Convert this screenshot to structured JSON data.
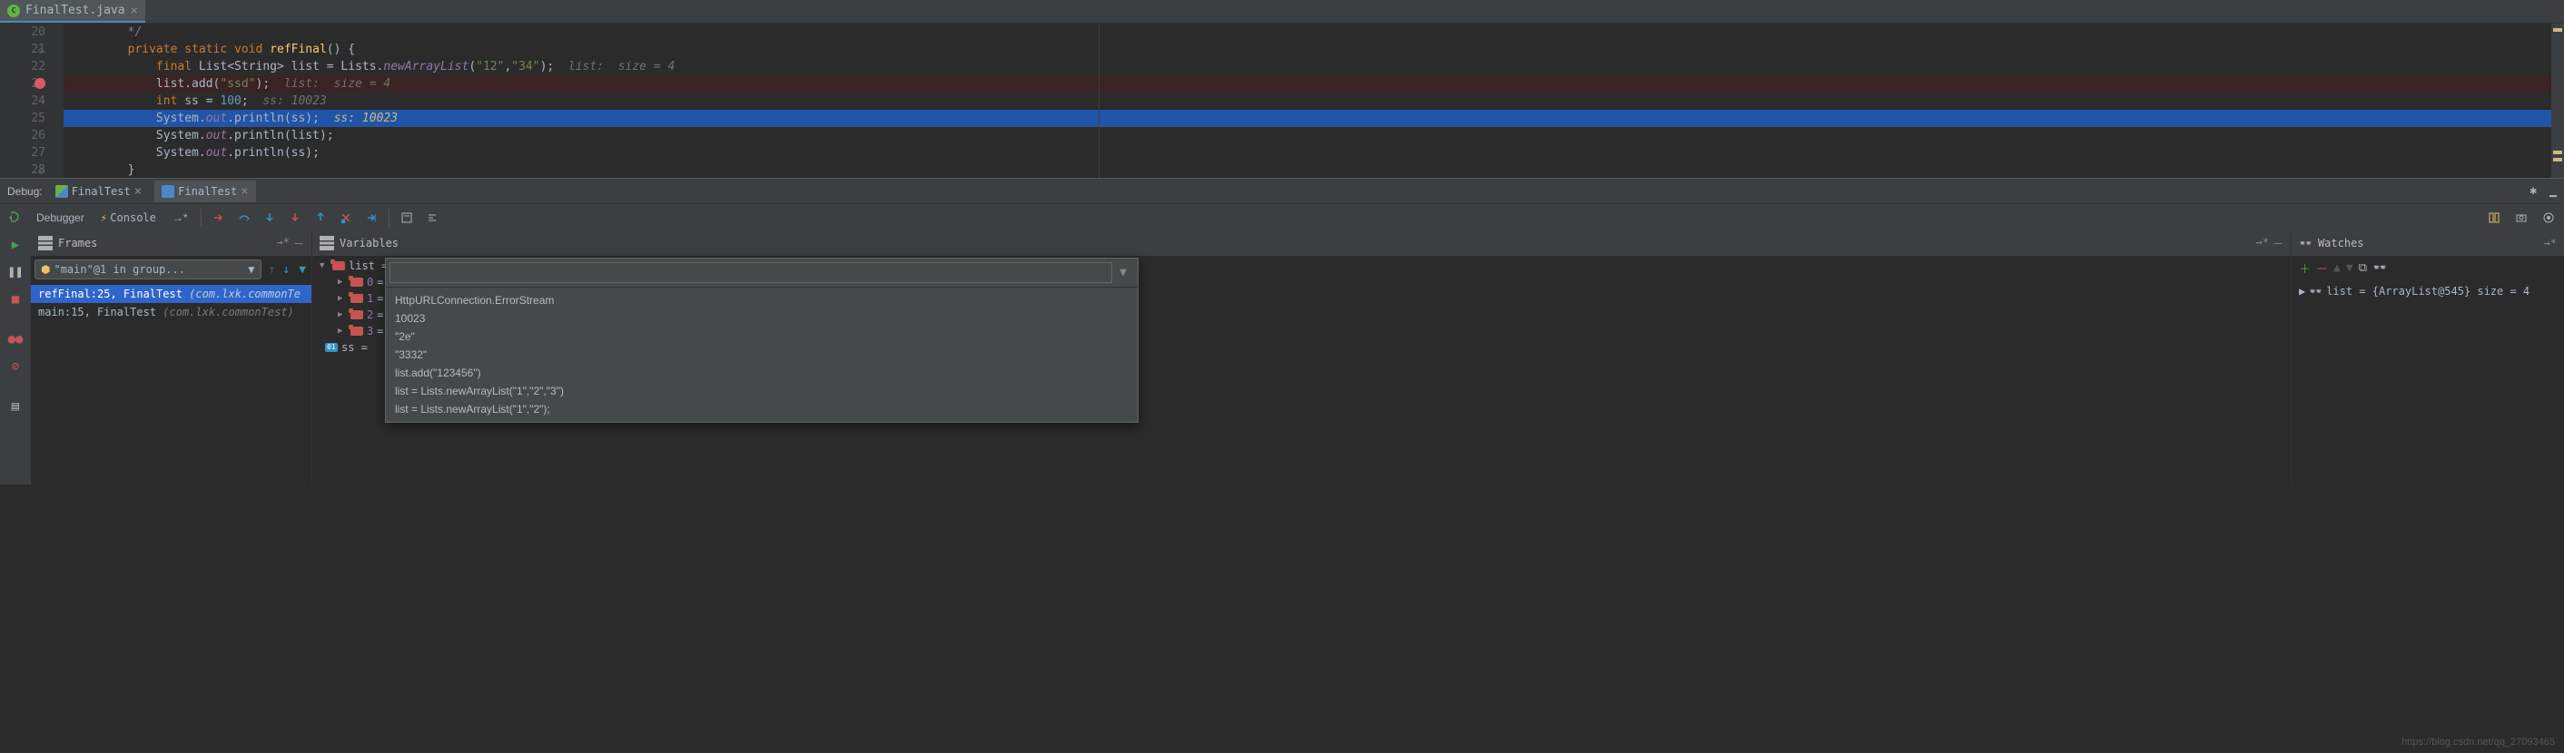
{
  "tab": {
    "filename": "FinalTest.java"
  },
  "gutter": [
    "20",
    "21",
    "22",
    "23",
    "24",
    "25",
    "26",
    "27",
    "28"
  ],
  "breakpoint_line": "23",
  "current_line": "25",
  "code": {
    "l20": "        */",
    "l21_indent": "        ",
    "l21_kw1": "private static void ",
    "l21_fn": "refFinal",
    "l21_rest": "() {",
    "l22_indent": "            ",
    "l22_kw": "final ",
    "l22_type": "List<String> list = Lists.",
    "l22_fn": "newArrayList",
    "l22_p1": "(",
    "l22_s1": "\"12\"",
    "l22_c": ",",
    "l22_s2": "\"34\"",
    "l22_p2": ");  ",
    "l22_hint": "list:  size = 4",
    "l23_indent": "            ",
    "l23_a": "list.add(",
    "l23_s": "\"ssd\"",
    "l23_b": ");  ",
    "l23_hint": "list:  size = 4",
    "l24_indent": "            ",
    "l24_kw": "int ",
    "l24_a": "ss = ",
    "l24_n": "100",
    "l24_b": ";  ",
    "l24_hint": "ss: 10023",
    "l25_indent": "            ",
    "l25_a": "System.",
    "l25_out": "out",
    "l25_b": ".println(ss);  ",
    "l25_hint": "ss: 10023",
    "l26_indent": "            ",
    "l26_a": "System.",
    "l26_out": "out",
    "l26_b": ".println(list);",
    "l27_indent": "            ",
    "l27_a": "System.",
    "l27_out": "out",
    "l27_b": ".println(ss);",
    "l28": "        }"
  },
  "debug": {
    "label": "Debug:",
    "tab1": "FinalTest",
    "tab2": "FinalTest"
  },
  "debugger_tabs": {
    "debugger": "Debugger",
    "console": "Console",
    "arrow": "→*"
  },
  "frames": {
    "title": "Frames",
    "dropdown": "\"main\"@1 in group...",
    "item1_a": "refFinal:25, FinalTest ",
    "item1_b": "(com.lxk.commonTe",
    "item2_a": "main:15, FinalTest ",
    "item2_b": "(com.lxk.commonTest)"
  },
  "variables": {
    "title": "Variables",
    "list_label": "list = ",
    "items": [
      {
        "idx": "0",
        "val": " = "
      },
      {
        "idx": "1",
        "val": " = "
      },
      {
        "idx": "2",
        "val": " = "
      },
      {
        "idx": "3",
        "val": " = "
      }
    ],
    "ss_label": "ss = "
  },
  "eval": {
    "input_value": "",
    "items": [
      "HttpURLConnection.ErrorStream",
      "10023",
      "\"2e\"",
      "\"3332\"",
      "list.add(\"123456\")",
      "list = Lists.newArrayList(\"1\",\"2\",\"3\")",
      "list = Lists.newArrayList(\"1\",\"2\");"
    ]
  },
  "watches": {
    "title": "Watches",
    "item1": "list = {ArrayList@545}  size = 4"
  },
  "watermark": "https://blog.csdn.net/qq_27093465"
}
